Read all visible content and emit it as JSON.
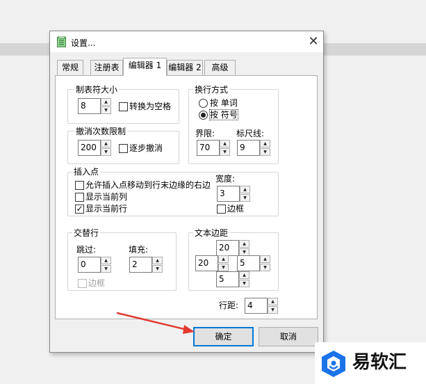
{
  "dialog": {
    "title": "设置..."
  },
  "tabs": [
    "常规",
    "注册表",
    "编辑器 1",
    "编辑器 2",
    "高级"
  ],
  "tab_size": {
    "label": "制表符大小",
    "value": "8",
    "convert_spaces_label": "转换为空格"
  },
  "undo_limit": {
    "label": "撤消次数限制",
    "value": "200",
    "step_undo_label": "逐步撤消"
  },
  "wrap": {
    "label": "换行方式",
    "by_word": "按 单词",
    "by_char": "按 符号",
    "limit_label": "界限:",
    "limit_value": "70",
    "ruler_label": "标尺线:",
    "ruler_value": "9"
  },
  "caret": {
    "label": "插入点",
    "allow_move_label": "允许插入点移动到行末边缘的右边",
    "show_column_label": "显示当前列",
    "show_row_label": "显示当前行",
    "width_label": "宽度:",
    "width_value": "3",
    "border_label": "边框"
  },
  "alternate": {
    "label": "交替行",
    "skip_label": "跳过:",
    "skip_value": "0",
    "fill_label": "填充:",
    "fill_value": "2",
    "border_label": "边框"
  },
  "margins": {
    "label": "文本边距",
    "top": "20",
    "left": "20",
    "right": "5",
    "bottom": "5"
  },
  "line_spacing": {
    "label": "行距:",
    "value": "4"
  },
  "buttons": {
    "ok": "确定",
    "cancel": "取消"
  },
  "spin": {
    "up": "▲",
    "down": "▼"
  },
  "close_glyph": "✕",
  "check_glyph": "✓",
  "watermark": {
    "text": "易软汇"
  },
  "colors": {
    "accent": "#0078d7",
    "arrow": "#e03a2f",
    "watermark_blue": "#1a73e8"
  }
}
